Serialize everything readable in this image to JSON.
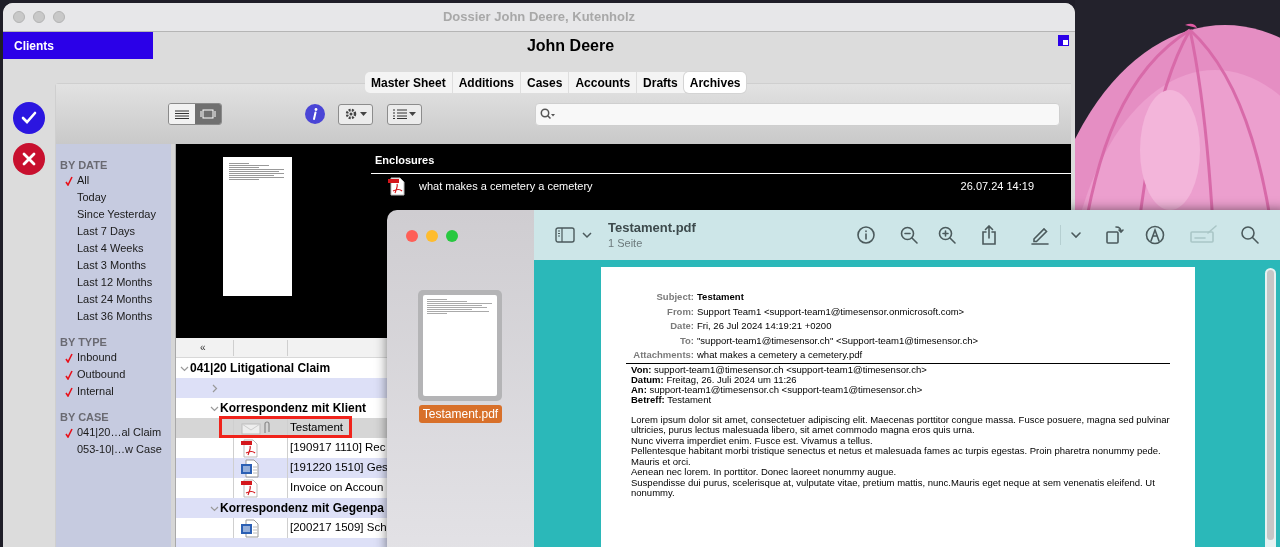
{
  "main_window": {
    "title": "Dossier John Deere, Kutenholz",
    "clients_label": "Clients",
    "client_name": "John Deere",
    "tabs": [
      {
        "label": "Master Sheet",
        "selected": false
      },
      {
        "label": "Additions",
        "selected": false
      },
      {
        "label": "Cases",
        "selected": false
      },
      {
        "label": "Accounts",
        "selected": false
      },
      {
        "label": "Drafts",
        "selected": false
      },
      {
        "label": "Archives",
        "selected": true
      }
    ],
    "view_modes": [
      {
        "kind": "list",
        "selected": false
      },
      {
        "kind": "gallery",
        "selected": true
      }
    ],
    "filters": [
      {
        "heading": "BY DATE",
        "items": [
          {
            "label": "All",
            "checked": true
          },
          {
            "label": "Today",
            "checked": false
          },
          {
            "label": "Since Yesterday",
            "checked": false
          },
          {
            "label": "Last 7 Days",
            "checked": false
          },
          {
            "label": "Last 4 Weeks",
            "checked": false
          },
          {
            "label": "Last 3 Months",
            "checked": false
          },
          {
            "label": "Last 12 Months",
            "checked": false
          },
          {
            "label": "Last 24 Months",
            "checked": false
          },
          {
            "label": "Last 36 Months",
            "checked": false
          }
        ]
      },
      {
        "heading": "BY TYPE",
        "items": [
          {
            "label": "Inbound",
            "checked": true
          },
          {
            "label": "Outbound",
            "checked": true
          },
          {
            "label": "Internal",
            "checked": true
          }
        ]
      },
      {
        "heading": "BY CASE",
        "items": [
          {
            "label": "041|20…al Claim",
            "checked": true
          },
          {
            "label": "053-10|…w Case",
            "checked": false
          }
        ]
      }
    ],
    "enclosures": {
      "heading": "Enclosures",
      "items": [
        {
          "name": "what makes a cemetery a cemetery",
          "date": "26.07.24 14:19"
        }
      ]
    },
    "tree": {
      "header": "«",
      "items": [
        {
          "kind": "case",
          "label": "041|20 Litigational Claim",
          "expanded": true,
          "selected": false,
          "children": [
            {
              "kind": "folder",
              "expanded": false,
              "selected": false
            },
            {
              "kind": "folder",
              "label": "Korrespondenz mit Klient",
              "expanded": true,
              "selected": false,
              "children": [
                {
                  "kind": "mail",
                  "label": "Testament",
                  "selected": true,
                  "highlighted": true
                },
                {
                  "kind": "pdf",
                  "label": "[190917 1110] Rec",
                  "selected": false,
                  "highlighted": false
                },
                {
                  "kind": "word",
                  "label": "[191220 1510] Ges",
                  "selected": false,
                  "highlighted": false
                },
                {
                  "kind": "pdf",
                  "label": "Invoice on Accoun",
                  "selected": false,
                  "highlighted": false
                }
              ]
            },
            {
              "kind": "folder",
              "label": "Korrespondenz mit Gegenpa",
              "expanded": true,
              "selected": false,
              "children": [
                {
                  "kind": "word",
                  "label": "[200217 1509] Sch",
                  "selected": false,
                  "highlighted": false
                }
              ]
            }
          ]
        }
      ]
    }
  },
  "preview_window": {
    "thumbnail_label": "Testament.pdf",
    "title": "Testament.pdf",
    "subtitle": "1 Seite",
    "toolbar": [
      {
        "kind": "info",
        "disabled": false
      },
      {
        "kind": "zoom-out",
        "disabled": false
      },
      {
        "kind": "zoom-in",
        "disabled": false
      },
      {
        "kind": "share",
        "disabled": false
      },
      {
        "kind": "pencil",
        "disabled": false
      },
      {
        "kind": "chevron",
        "disabled": false
      },
      {
        "kind": "rotate",
        "disabled": false
      },
      {
        "kind": "markup",
        "disabled": false
      },
      {
        "kind": "signature",
        "disabled": true
      },
      {
        "kind": "search",
        "disabled": false
      }
    ],
    "document": {
      "header_fields": [
        {
          "label": "Subject:",
          "value": "Testament",
          "bold": true
        },
        {
          "label": "From:",
          "value": "Support Team1 <support-team1@timesensor.onmicrosoft.com>",
          "bold": false
        },
        {
          "label": "Date:",
          "value": "Fri, 26 Jul 2024 14:19:21 +0200",
          "bold": false
        },
        {
          "label": "To:",
          "value": "\"support-team1@timesensor.ch\" <Support-team1@timesensor.ch>",
          "bold": false
        },
        {
          "label": "Attachments:",
          "value": "what makes a cemetery a cemetery.pdf",
          "bold": false
        }
      ],
      "forward_fields": [
        {
          "label": "Von:",
          "value": "support-team1@timesensor.ch <support-team1@timesensor.ch>"
        },
        {
          "label": "Datum:",
          "value": "Freitag, 26. Juli 2024 um 11:26"
        },
        {
          "label": "An:",
          "value": "support-team1@timesensor.ch <support-team1@timesensor.ch>"
        },
        {
          "label": "Betreff:",
          "value": "Testament"
        }
      ],
      "paragraphs": [
        "Lorem ipsum dolor sit amet, consectetuer adipiscing elit. Maecenas porttitor congue massa. Fusce posuere, magna sed pulvinar ultricies, purus lectus malesuada libero, sit amet commodo magna eros quis urna.",
        "Nunc viverra imperdiet enim. Fusce est. Vivamus a tellus.",
        "Pellentesque habitant morbi tristique senectus et netus et malesuada fames ac turpis egestas. Proin pharetra nonummy pede. Mauris et orci.",
        "Aenean nec lorem. In porttitor. Donec laoreet nonummy augue.",
        "Suspendisse dui purus, scelerisque at, vulputate vitae, pretium mattis, nunc.Mauris eget neque at sem venenatis eleifend. Ut nonummy."
      ]
    }
  }
}
